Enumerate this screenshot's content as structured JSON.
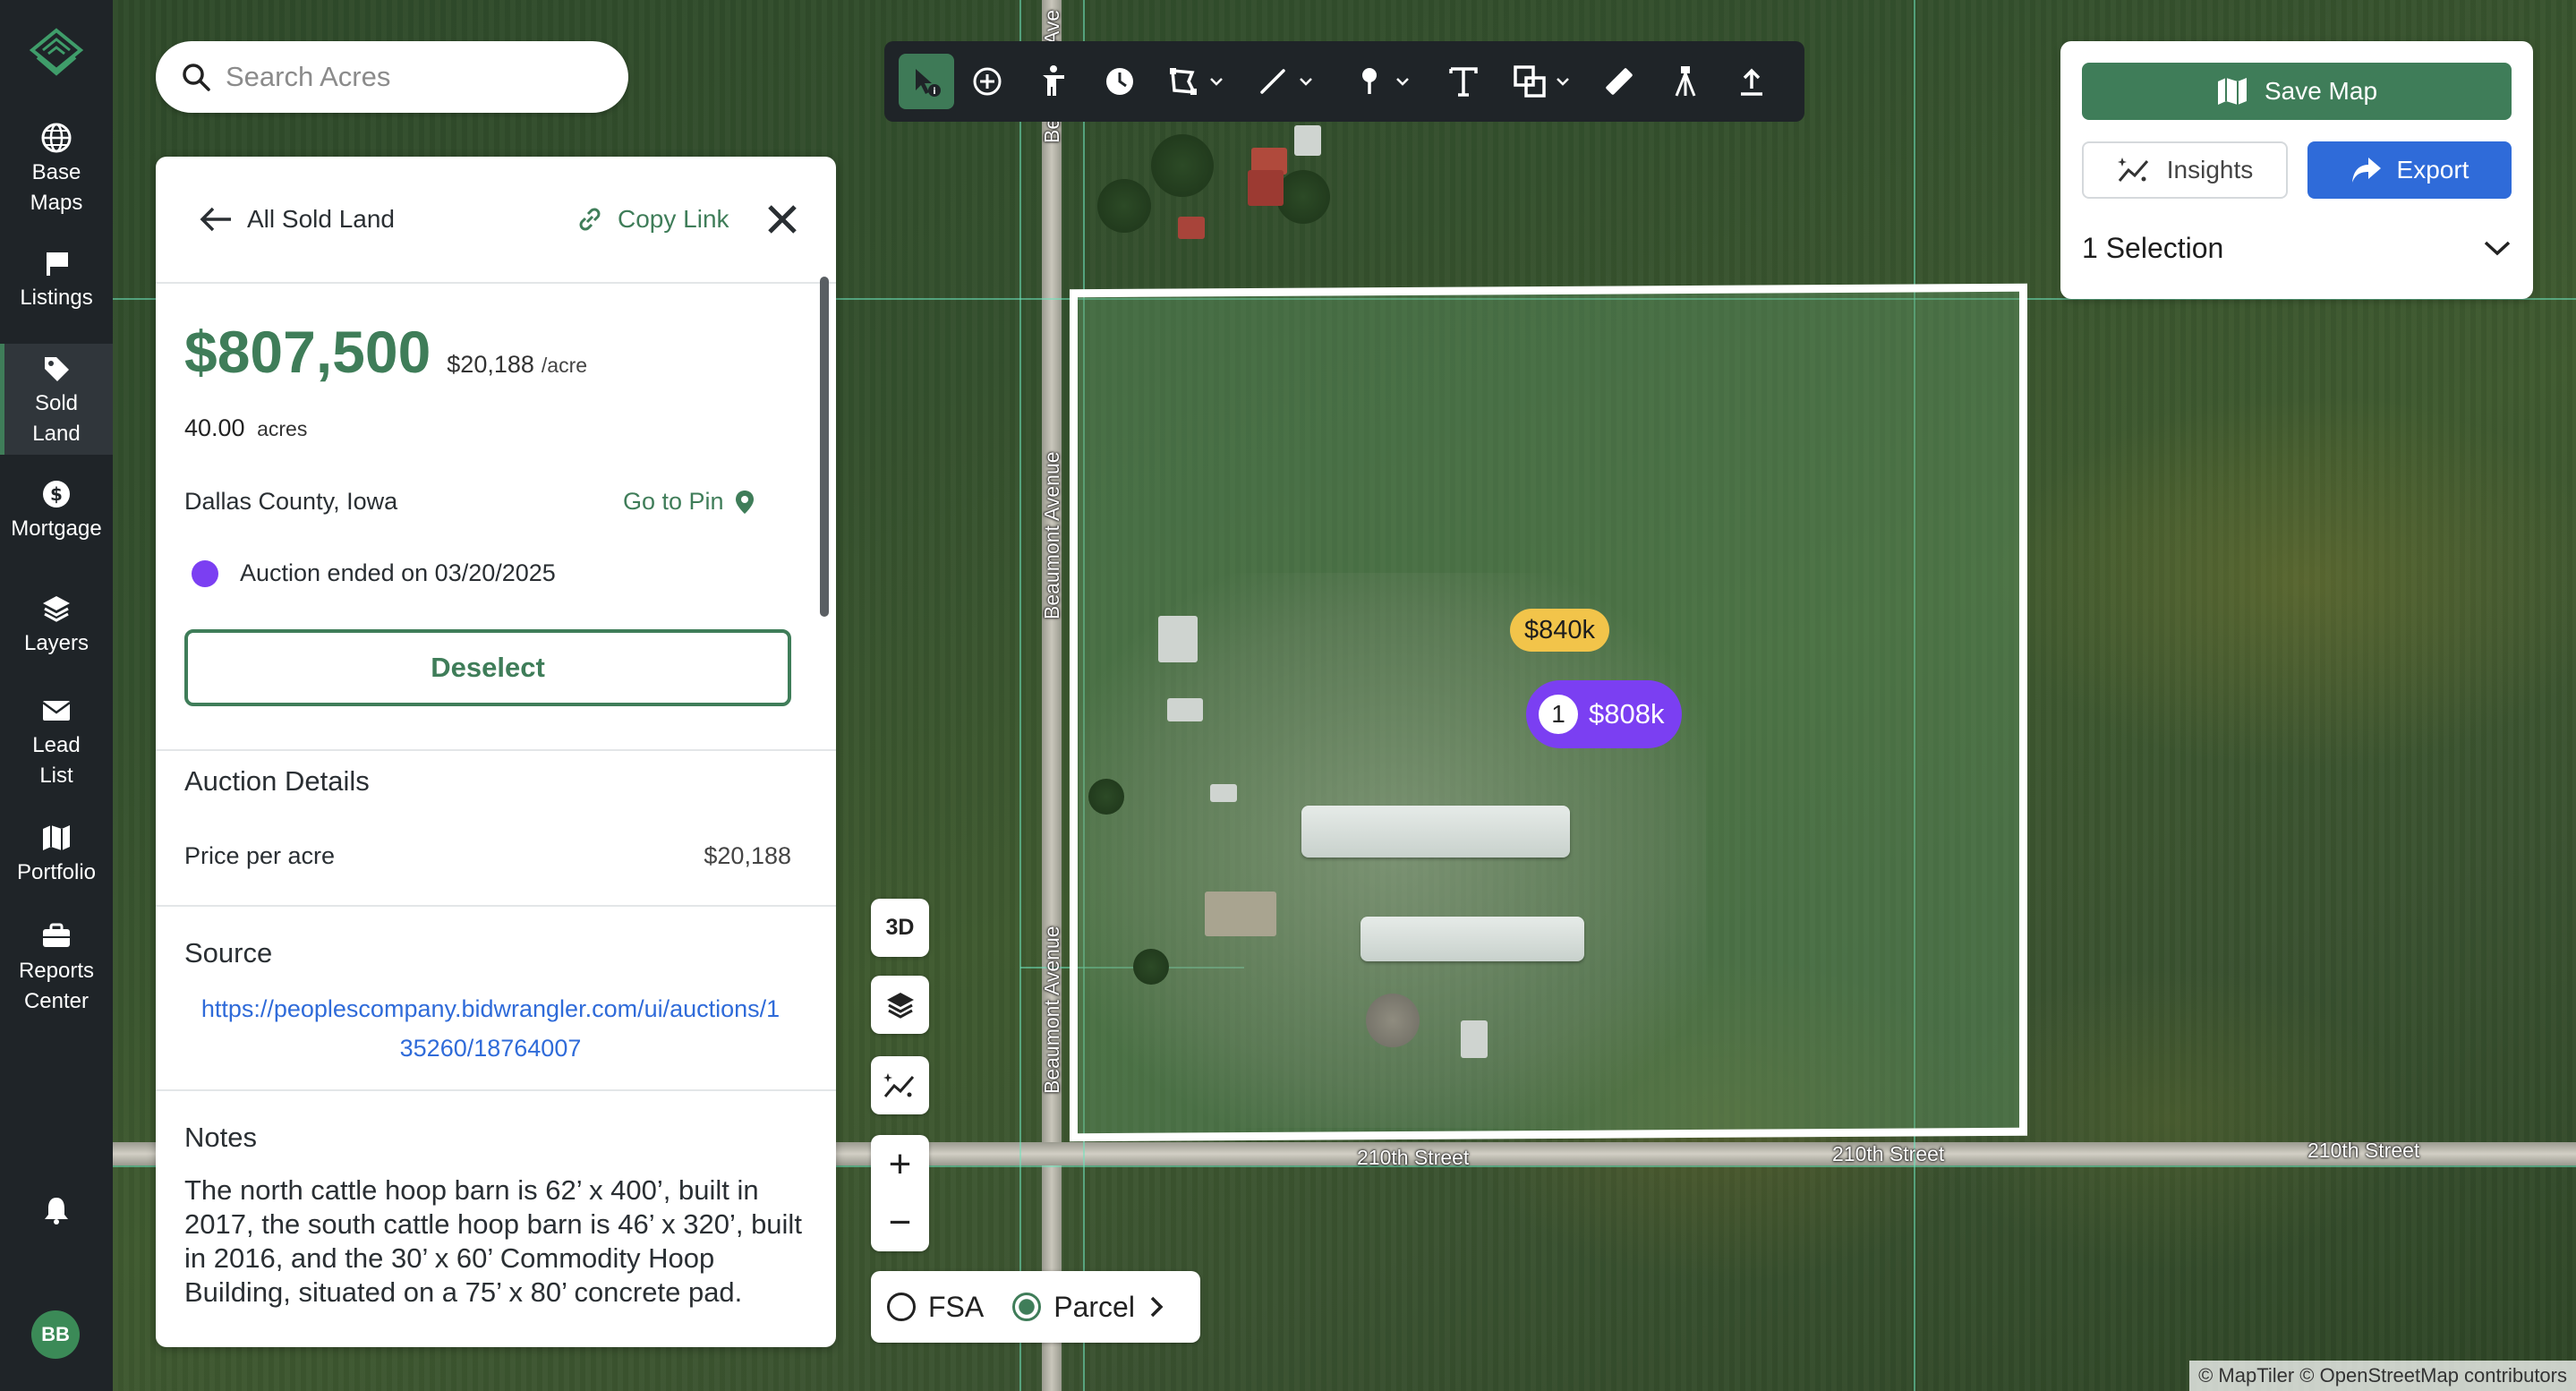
{
  "nav": {
    "items": [
      {
        "label": "Base Maps",
        "icon": "globe-icon"
      },
      {
        "label": "Listings",
        "icon": "sign-icon"
      },
      {
        "label": "Sold Land",
        "icon": "tag-icon"
      },
      {
        "label": "Mortgage",
        "icon": "dollar-icon"
      },
      {
        "label": "Layers",
        "icon": "layers-icon"
      },
      {
        "label": "Lead List",
        "icon": "mail-icon"
      },
      {
        "label": "Portfolio",
        "icon": "map-icon"
      },
      {
        "label": "Reports Center",
        "icon": "briefcase-icon"
      }
    ],
    "avatar": "BB"
  },
  "search": {
    "placeholder": "Search Acres"
  },
  "right_panel": {
    "save_label": "Save Map",
    "insights_label": "Insights",
    "export_label": "Export",
    "selection_label": "1 Selection"
  },
  "detail": {
    "back_label": "All Sold Land",
    "copy_link_label": "Copy Link",
    "price": "$807,500",
    "price_per_acre": "$20,188",
    "price_per_acre_unit": "/acre",
    "acres_value": "40.00",
    "acres_unit": "acres",
    "county": "Dallas County, Iowa",
    "go_to_pin_label": "Go to Pin",
    "auction_status": "Auction ended on 03/20/2025",
    "deselect_label": "Deselect",
    "auction_details_heading": "Auction Details",
    "price_per_acre_label": "Price per acre",
    "price_per_acre_value": "$20,188",
    "source_heading": "Source",
    "source_url": "https://peoplescompany.bidwrangler.com/ui/auctions/135260/18764007",
    "notes_heading": "Notes",
    "notes_text": "The north cattle hoop barn is 62’ x 400’, built in 2017, the south cattle hoop barn is 46’ x 320’, built in 2016, and the 30’ x 60’ Commodity Hoop Building, situated on a 75’ x 80’ concrete pad."
  },
  "map": {
    "roads": {
      "beaumont_upper": "Beaumont Avenue",
      "beaumont_lower": "Beaumont Avenue",
      "beaumont_top_partial": "Beaumont Ave",
      "street_210_a": "210th Street",
      "street_210_b": "210th Street",
      "street_210_c": "210th Street"
    },
    "pins": {
      "yellow_price": "$840k",
      "purple_count": "1",
      "purple_price": "$808k"
    },
    "controls": {
      "three_d": "3D",
      "zoom_in": "+",
      "zoom_out": "−",
      "fsa_label": "FSA",
      "parcel_label": "Parcel"
    },
    "attribution": "© MapTiler © OpenStreetMap contributors"
  },
  "colors": {
    "brand_green": "#3f7d59",
    "export_blue": "#2f6bd9",
    "auction_purple": "#7b3ff2",
    "pin_yellow": "#f2c44a",
    "nav_bg": "#1f2428"
  }
}
